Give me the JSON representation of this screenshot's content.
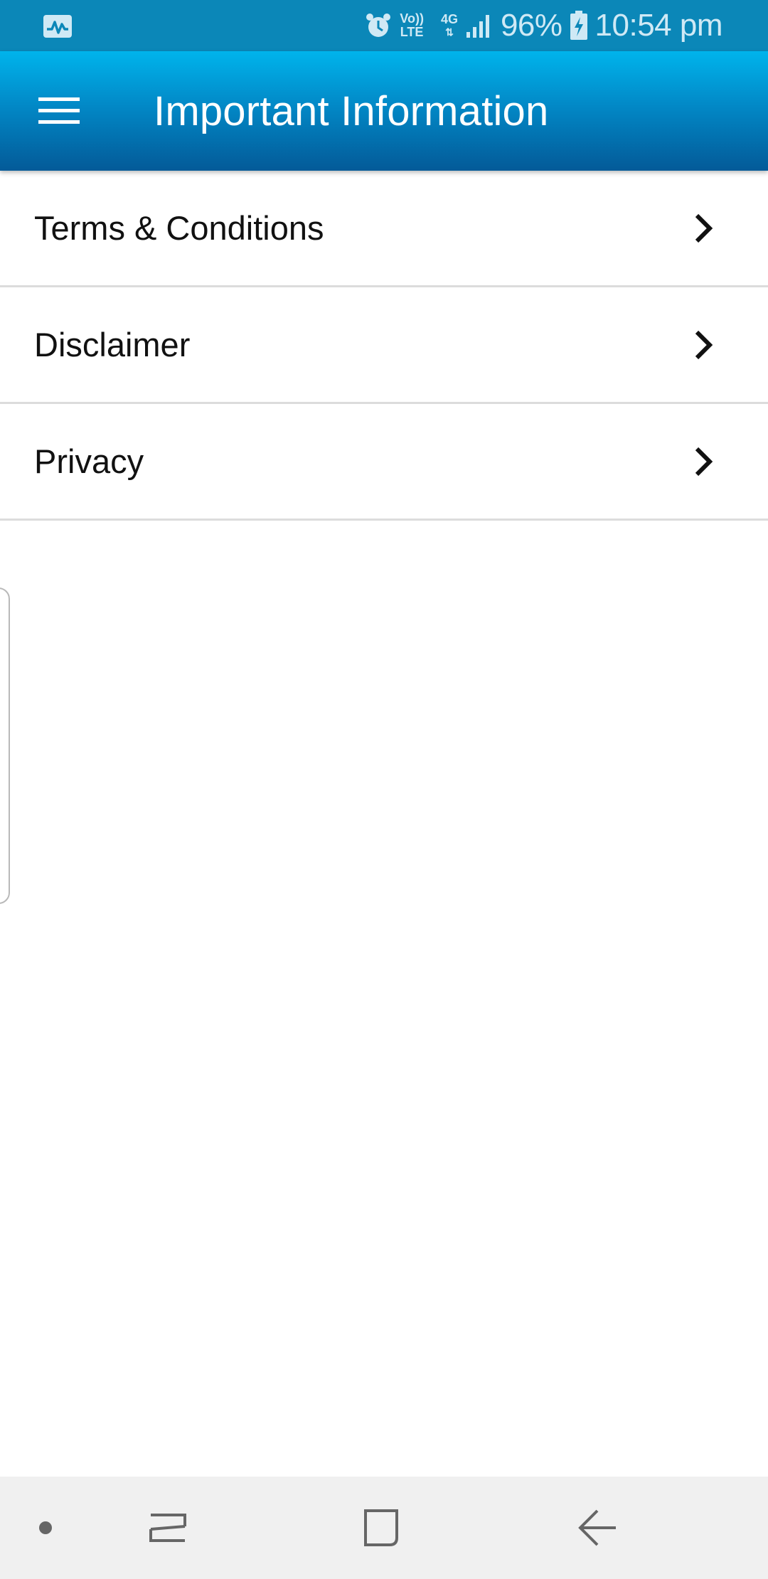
{
  "status_bar": {
    "activity_icon": "activity-monitor-icon",
    "alarm_icon": "alarm-icon",
    "volte_top": "Vo))",
    "volte_bottom": "LTE",
    "network": "4G",
    "signal_icon": "signal-bars-icon",
    "battery_percent": "96%",
    "battery_icon": "battery-charging-icon",
    "time": "10:54 pm"
  },
  "app_bar": {
    "menu_icon": "hamburger-menu-icon",
    "title": "Important Information"
  },
  "menu_list": {
    "items": [
      {
        "label": "Terms & Conditions",
        "icon": "chevron-right-icon"
      },
      {
        "label": "Disclaimer",
        "icon": "chevron-right-icon"
      },
      {
        "label": "Privacy",
        "icon": "chevron-right-icon"
      }
    ]
  },
  "nav_bar": {
    "items": [
      "dot-icon",
      "recent-apps-icon",
      "home-icon",
      "back-icon"
    ]
  },
  "colors": {
    "status_bar": "#0b87b8",
    "app_bar_top": "#00b4ec",
    "app_bar_bottom": "#035a98",
    "divider": "#dcdcdc",
    "nav_bar": "#f0f0f0"
  }
}
